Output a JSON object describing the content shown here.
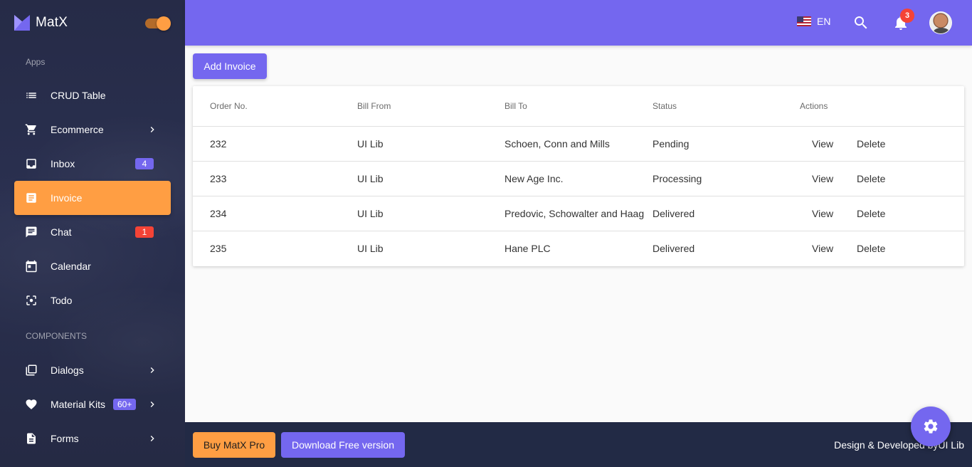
{
  "brand": {
    "name": "MatX"
  },
  "sidebar": {
    "sections": {
      "apps": "Apps",
      "components": "COMPONENTS"
    },
    "items": [
      {
        "label": "CRUD Table",
        "icon": "format-list-icon"
      },
      {
        "label": "Ecommerce",
        "icon": "cart-icon"
      },
      {
        "label": "Inbox",
        "icon": "inbox-icon",
        "badge": "4"
      },
      {
        "label": "Invoice",
        "icon": "receipt-icon",
        "active": true
      },
      {
        "label": "Chat",
        "icon": "chat-icon",
        "badge": "1"
      },
      {
        "label": "Calendar",
        "icon": "calendar-icon"
      },
      {
        "label": "Todo",
        "icon": "center-focus-icon"
      },
      {
        "label": "Dialogs",
        "icon": "library-books-icon"
      },
      {
        "label": "Material Kits",
        "icon": "heart-icon",
        "badge": "60+"
      },
      {
        "label": "Forms",
        "icon": "description-icon"
      }
    ]
  },
  "topbar": {
    "language": "EN",
    "notification_count": "3"
  },
  "main": {
    "add_button": "Add Invoice",
    "table": {
      "headers": [
        "Order No.",
        "Bill From",
        "Bill To",
        "Status",
        "Actions"
      ],
      "rows": [
        {
          "order": "232",
          "from": "UI Lib",
          "to": "Schoen, Conn and Mills",
          "status": "Pending"
        },
        {
          "order": "233",
          "from": "UI Lib",
          "to": "New Age Inc.",
          "status": "Processing"
        },
        {
          "order": "234",
          "from": "UI Lib",
          "to": "Predovic, Schowalter and Haag",
          "status": "Delivered"
        },
        {
          "order": "235",
          "from": "UI Lib",
          "to": "Hane PLC",
          "status": "Delivered"
        }
      ],
      "view_label": "View",
      "delete_label": "Delete"
    }
  },
  "footer": {
    "buy_label": "Buy MatX Pro",
    "download_label": "Download Free version",
    "credit": "Design & Developed byUI Lib"
  },
  "colors": {
    "primary": "#7467ef",
    "accent": "#ff9e43",
    "sidebar_bg": "#262b47",
    "footer_bg": "#222a45",
    "badge_purple": "#7467ef",
    "badge_red": "#f44336"
  }
}
